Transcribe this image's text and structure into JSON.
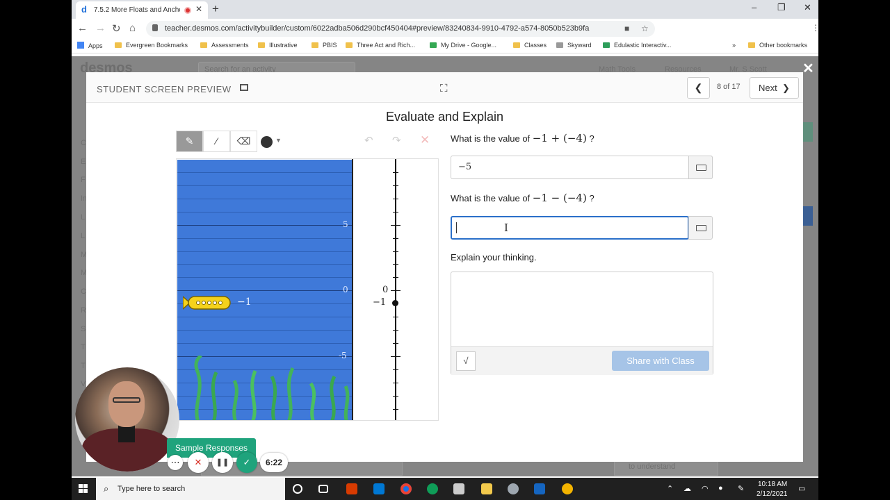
{
  "browser": {
    "tab_title": "7.5.2 More Floats and Ancho",
    "tab_favicon": "d",
    "new_tab": "+",
    "window_controls": [
      "–",
      "❐",
      "✕"
    ],
    "url": "teacher.desmos.com/activitybuilder/custom/6022adba506d290bcf450404#preview/83240834-9910-4792-a574-8050b523b9fa",
    "nav_icons": [
      "arrow-left-icon",
      "arrow-right-icon",
      "reload-icon",
      "home-icon"
    ],
    "bookmarks": [
      "Apps",
      "Evergreen Bookmarks",
      "Assessments",
      "Illustrative",
      "PBIS",
      "Three Act and Rich...",
      "My Drive - Google...",
      "Classes",
      "Skyward",
      "Edulastic Interactiv..."
    ],
    "bookmarks_more": "»",
    "other_bookmarks": "Other bookmarks"
  },
  "background_page": {
    "logo": "desmos",
    "search_placeholder": "Search for an activity",
    "menu": [
      "Math Tools",
      "Resources",
      "Mr. S Scott"
    ],
    "left_letters": [
      "C",
      "E",
      "F",
      "In",
      "L",
      "L",
      "M",
      "M",
      "C",
      "R",
      "S",
      "T",
      "T",
      "V"
    ],
    "footnote": "to understand"
  },
  "preview": {
    "header_label": "STUDENT SCREEN PREVIEW",
    "page_indicator": "8 of 17",
    "next_label": "Next",
    "screen_title": "Evaluate and Explain"
  },
  "sketch": {
    "tools": [
      "pencil-icon",
      "line-icon",
      "eraser-icon"
    ],
    "color": "#333333",
    "ocean_ticks": [
      "5",
      "0",
      "-5"
    ],
    "sub_label": "−1",
    "number_line_labels": [
      "0",
      "−1"
    ],
    "ocean_color": "#3f79d9"
  },
  "questions": [
    {
      "prefix": "What is the value of ",
      "math": "−1 + (−4)",
      "suffix": " ?",
      "answer": "−5"
    },
    {
      "prefix": "What is the value of ",
      "math": "−1 − (−4)",
      "suffix": " ?",
      "answer": ""
    }
  ],
  "explain": {
    "prompt": "Explain your thinking.",
    "sqrt_label": "√",
    "share_label": "Share with Class"
  },
  "recorder": {
    "sample_responses": "Sample Responses",
    "timer": "6:22",
    "buttons": [
      "⋯",
      "✕",
      "❚❚",
      "✓"
    ]
  },
  "taskbar": {
    "search_placeholder": "Type here to search",
    "time": "10:18 AM",
    "date": "2/12/2021"
  },
  "colors": {
    "accent": "#2a6fc9",
    "share_disabled": "#a6c4e7",
    "sample_tab": "#1fa37c"
  }
}
